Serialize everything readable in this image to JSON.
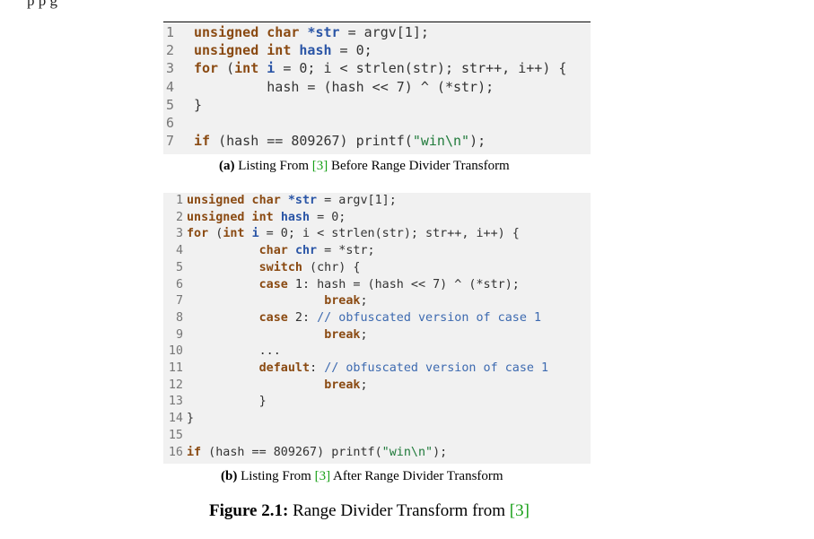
{
  "top_fragment": "p                              p                                               g",
  "listing_a": {
    "lines": [
      {
        "n": "1",
        "tokens": [
          [
            "kw",
            "unsigned char "
          ],
          [
            "id",
            "*str"
          ],
          [
            "plain",
            " = argv[1];"
          ]
        ]
      },
      {
        "n": "2",
        "tokens": [
          [
            "kw",
            "unsigned int "
          ],
          [
            "id",
            "hash"
          ],
          [
            "plain",
            " = 0;"
          ]
        ]
      },
      {
        "n": "3",
        "tokens": [
          [
            "kw",
            "for"
          ],
          [
            "plain",
            " ("
          ],
          [
            "kw",
            "int "
          ],
          [
            "id",
            "i"
          ],
          [
            "plain",
            " = 0; i < strlen(str); str++, i++) {"
          ]
        ]
      },
      {
        "n": "4",
        "tokens": [
          [
            "plain",
            "         hash = (hash << 7) ^ (*str);"
          ]
        ]
      },
      {
        "n": "5",
        "tokens": [
          [
            "plain",
            "}"
          ]
        ]
      },
      {
        "n": "6",
        "tokens": []
      },
      {
        "n": "7",
        "tokens": [
          [
            "kw",
            "if"
          ],
          [
            "plain",
            " (hash == 809267) printf("
          ],
          [
            "str",
            "\"win\\n\""
          ],
          [
            "plain",
            ");"
          ]
        ]
      }
    ]
  },
  "caption_a": {
    "label": "(a)",
    "pre": " Listing From ",
    "cite": "[3]",
    "post": " Before Range Divider Transform"
  },
  "listing_b": {
    "lines": [
      {
        "n": "1",
        "tokens": [
          [
            "kw",
            "unsigned char "
          ],
          [
            "id",
            "*str"
          ],
          [
            "plain",
            " = argv[1];"
          ]
        ]
      },
      {
        "n": "2",
        "tokens": [
          [
            "kw",
            "unsigned int "
          ],
          [
            "id",
            "hash"
          ],
          [
            "plain",
            " = 0;"
          ]
        ]
      },
      {
        "n": "3",
        "tokens": [
          [
            "kw",
            "for"
          ],
          [
            "plain",
            " ("
          ],
          [
            "kw",
            "int "
          ],
          [
            "id",
            "i"
          ],
          [
            "plain",
            " = 0; i < strlen(str); str++, i++) {"
          ]
        ]
      },
      {
        "n": "4",
        "tokens": [
          [
            "plain",
            "          "
          ],
          [
            "kw",
            "char "
          ],
          [
            "id",
            "chr"
          ],
          [
            "plain",
            " = *str;"
          ]
        ]
      },
      {
        "n": "5",
        "tokens": [
          [
            "plain",
            "          "
          ],
          [
            "kw",
            "switch"
          ],
          [
            "plain",
            " (chr) {"
          ]
        ]
      },
      {
        "n": "6",
        "tokens": [
          [
            "plain",
            "          "
          ],
          [
            "kw",
            "case"
          ],
          [
            "plain",
            " 1: hash = (hash << 7) ^ (*str);"
          ]
        ]
      },
      {
        "n": "7",
        "tokens": [
          [
            "plain",
            "                   "
          ],
          [
            "kw",
            "break"
          ],
          [
            "plain",
            ";"
          ]
        ]
      },
      {
        "n": "8",
        "tokens": [
          [
            "plain",
            "          "
          ],
          [
            "kw",
            "case"
          ],
          [
            "plain",
            " 2: "
          ],
          [
            "cm",
            "// obfuscated version of case 1"
          ]
        ]
      },
      {
        "n": "9",
        "tokens": [
          [
            "plain",
            "                   "
          ],
          [
            "kw",
            "break"
          ],
          [
            "plain",
            ";"
          ]
        ]
      },
      {
        "n": "10",
        "tokens": [
          [
            "plain",
            "          ..."
          ]
        ]
      },
      {
        "n": "11",
        "tokens": [
          [
            "plain",
            "          "
          ],
          [
            "kw",
            "default"
          ],
          [
            "plain",
            ": "
          ],
          [
            "cm",
            "// obfuscated version of case 1"
          ]
        ]
      },
      {
        "n": "12",
        "tokens": [
          [
            "plain",
            "                   "
          ],
          [
            "kw",
            "break"
          ],
          [
            "plain",
            ";"
          ]
        ]
      },
      {
        "n": "13",
        "tokens": [
          [
            "plain",
            "          }"
          ]
        ]
      },
      {
        "n": "14",
        "tokens": [
          [
            "plain",
            "}"
          ]
        ]
      },
      {
        "n": "15",
        "tokens": []
      },
      {
        "n": "16",
        "tokens": [
          [
            "kw",
            "if"
          ],
          [
            "plain",
            " (hash == 809267) printf("
          ],
          [
            "str",
            "\"win\\n\""
          ],
          [
            "plain",
            ");"
          ]
        ]
      }
    ]
  },
  "caption_b": {
    "label": "(b)",
    "pre": " Listing From ",
    "cite": "[3]",
    "post": " After Range Divider Transform"
  },
  "figure_caption": {
    "label": "Figure 2.1:",
    "pre": " Range Divider Transform from ",
    "cite": "[3]"
  }
}
